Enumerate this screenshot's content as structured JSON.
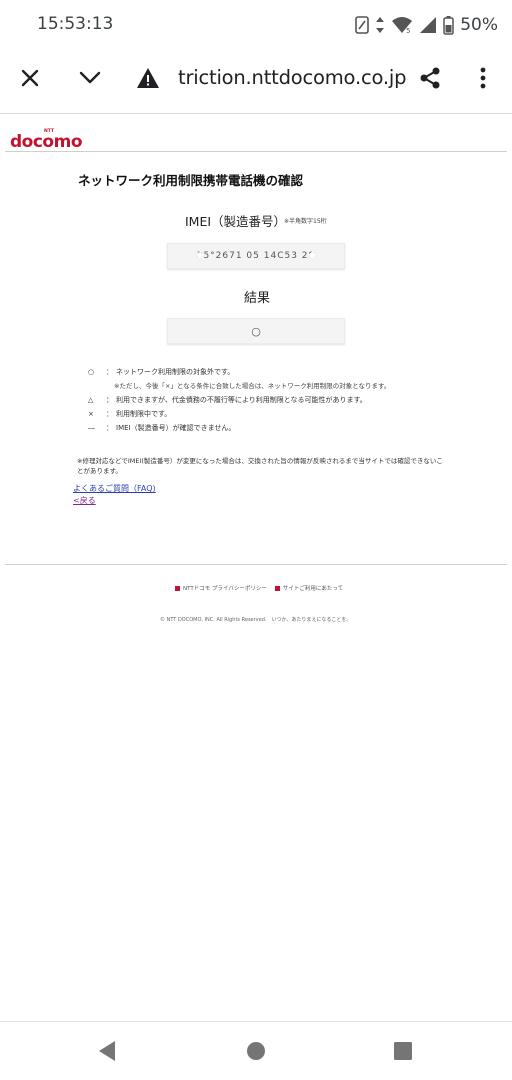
{
  "status_bar": {
    "time": "15:53:13",
    "battery": "50%",
    "icons": [
      "nfc-icon",
      "data-arrows-icon",
      "wifi-icon",
      "signal-icon",
      "battery-icon"
    ]
  },
  "toolbar": {
    "url": "triction.nttdocomo.co.jp",
    "icons": [
      "close-icon",
      "chevron-down-icon",
      "warning-icon",
      "share-icon",
      "more-vert-icon"
    ]
  },
  "page": {
    "logo_text": "docomo",
    "logo_small": "NTT",
    "title": "ネットワーク利用制限携帯電話機の確認",
    "imei_label": "IMEI（製造番号）",
    "imei_note": "※半角数字15桁",
    "imei_value": "35°2671 05 14C53 29",
    "result_label": "結果",
    "result_value": "○",
    "legend": [
      {
        "symbol": "○",
        "text": "ネットワーク利用制限の対象外です。"
      },
      {
        "sub": "※ただし、今後「×」となる条件に合致した場合は、ネットワーク利用制限の対象となります。"
      },
      {
        "symbol": "△",
        "text": "利用できますが、代金債務の不履行等により利用制限となる可能性があります。"
      },
      {
        "symbol": "×",
        "text": "利用制限中です。"
      },
      {
        "symbol": "―",
        "text": "IMEI（製造番号）が確認できません。"
      }
    ],
    "note": "※修理対応などでIMEI(製造番号）が変更になった場合は、交換された旨の情報が反映されるまで当サイトでは確認できないことがあります。",
    "faq_link": "よくあるご質問（FAQ)",
    "back_link": "<戻る",
    "footer_link_1": "NTTドコモ プライバシーポリシー",
    "footer_link_2": "サイトご利用にあたって",
    "copyright": "© NTT DOCOMO, INC. All Rights Reserved.　いつか、あたりまえになることを。",
    "brand_color": "#c4122e"
  },
  "nav_bar": {
    "buttons": [
      "back-nav-icon",
      "home-nav-icon",
      "recents-nav-icon"
    ]
  }
}
